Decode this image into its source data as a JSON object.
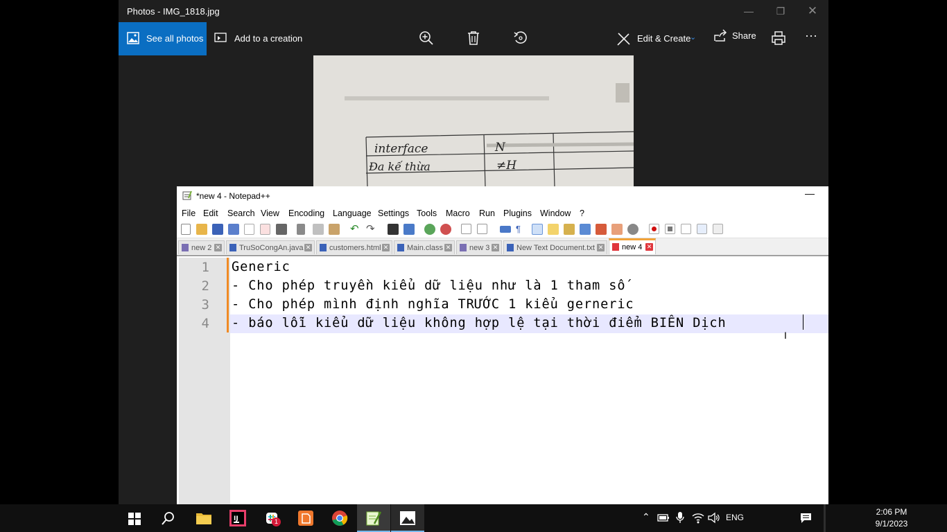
{
  "photos": {
    "title": "Photos - IMG_1818.jpg",
    "toolbar": {
      "see_all_photos": "See all photos",
      "add_to_creation": "Add to a creation",
      "edit_create": "Edit & Create",
      "share": "Share"
    },
    "photo_content": {
      "row1_col1": "interface",
      "row1_col2": "N",
      "row2_col1": "Đa kế thừa",
      "row2_col2": "≠H"
    }
  },
  "notepad": {
    "title": "*new 4 - Notepad++",
    "menu": [
      "File",
      "Edit",
      "Search",
      "View",
      "Encoding",
      "Language",
      "Settings",
      "Tools",
      "Macro",
      "Run",
      "Plugins",
      "Window",
      "?"
    ],
    "tabs": [
      {
        "label": "new 2"
      },
      {
        "label": "TruSoCongAn.java"
      },
      {
        "label": "customers.html"
      },
      {
        "label": "Main.class"
      },
      {
        "label": "new 3"
      },
      {
        "label": "New Text Document.txt"
      },
      {
        "label": "new 4"
      }
    ],
    "lines": [
      {
        "n": "1",
        "text": "Generic"
      },
      {
        "n": "2",
        "text": "- Cho phép truyền kiểu dữ liệu như là 1 tham số"
      },
      {
        "n": "3",
        "text": "- Cho phép mình định nghĩa TRƯỚC 1 kiểu gerneric"
      },
      {
        "n": "4",
        "text": "- báo lỗi kiểu dữ liệu không hợp lệ tại thời điểm BIÊN Dịch"
      }
    ]
  },
  "taskbar": {
    "time": "2:06 PM",
    "date": "9/1/2023",
    "language": "ENG",
    "slack_badge": "1"
  },
  "colors": {
    "accent": "#0a6ec2",
    "tab_active_border": "#f2a33a",
    "fold_marker": "#f08a24"
  }
}
